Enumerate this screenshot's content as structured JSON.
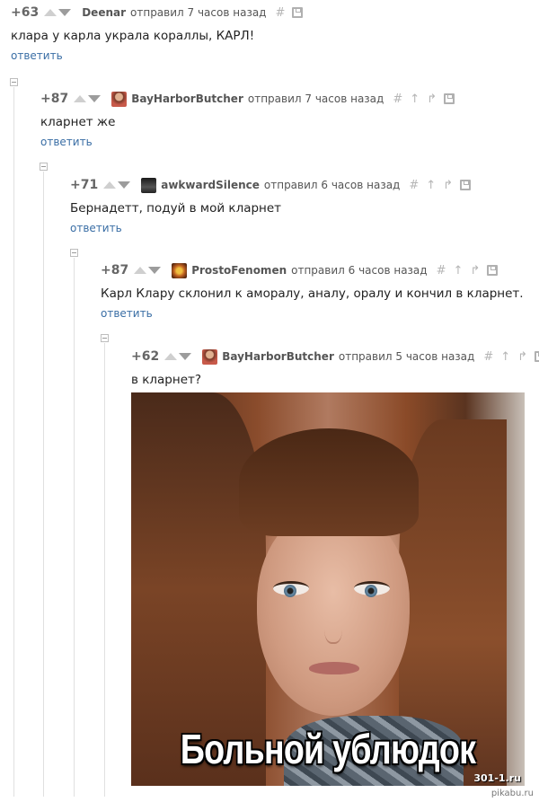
{
  "reply_label": "ответить",
  "colors": {
    "rating": "#666666",
    "link": "#3a6ea5",
    "tool": "#b5b5b5"
  },
  "comments": [
    {
      "rating": "+63",
      "username": "Deenar",
      "time": "отправил 7 часов назад",
      "text": "клара у карла украла кораллы, КАРЛ!"
    },
    {
      "rating": "+87",
      "username": "BayHarborButcher",
      "time": "отправил 7 часов назад",
      "text": "кларнет же"
    },
    {
      "rating": "+71",
      "username": "awkwardSilence",
      "time": "отправил 6 часов назад",
      "text": "Бернадетт, подуй в мой кларнет"
    },
    {
      "rating": "+87",
      "username": "ProstoFenomen",
      "time": "отправил 6 часов назад",
      "text": "Карл Клару склонил к аморалу, аналу, оралу и кончил в кларнет."
    },
    {
      "rating": "+62",
      "username": "BayHarborButcher",
      "time": "отправил 5 часов назад",
      "text": "в кларнет?"
    }
  ],
  "meme": {
    "caption": "Больной ублюдок",
    "watermark": "301-1.ru"
  },
  "site_watermark": "pikabu.ru"
}
